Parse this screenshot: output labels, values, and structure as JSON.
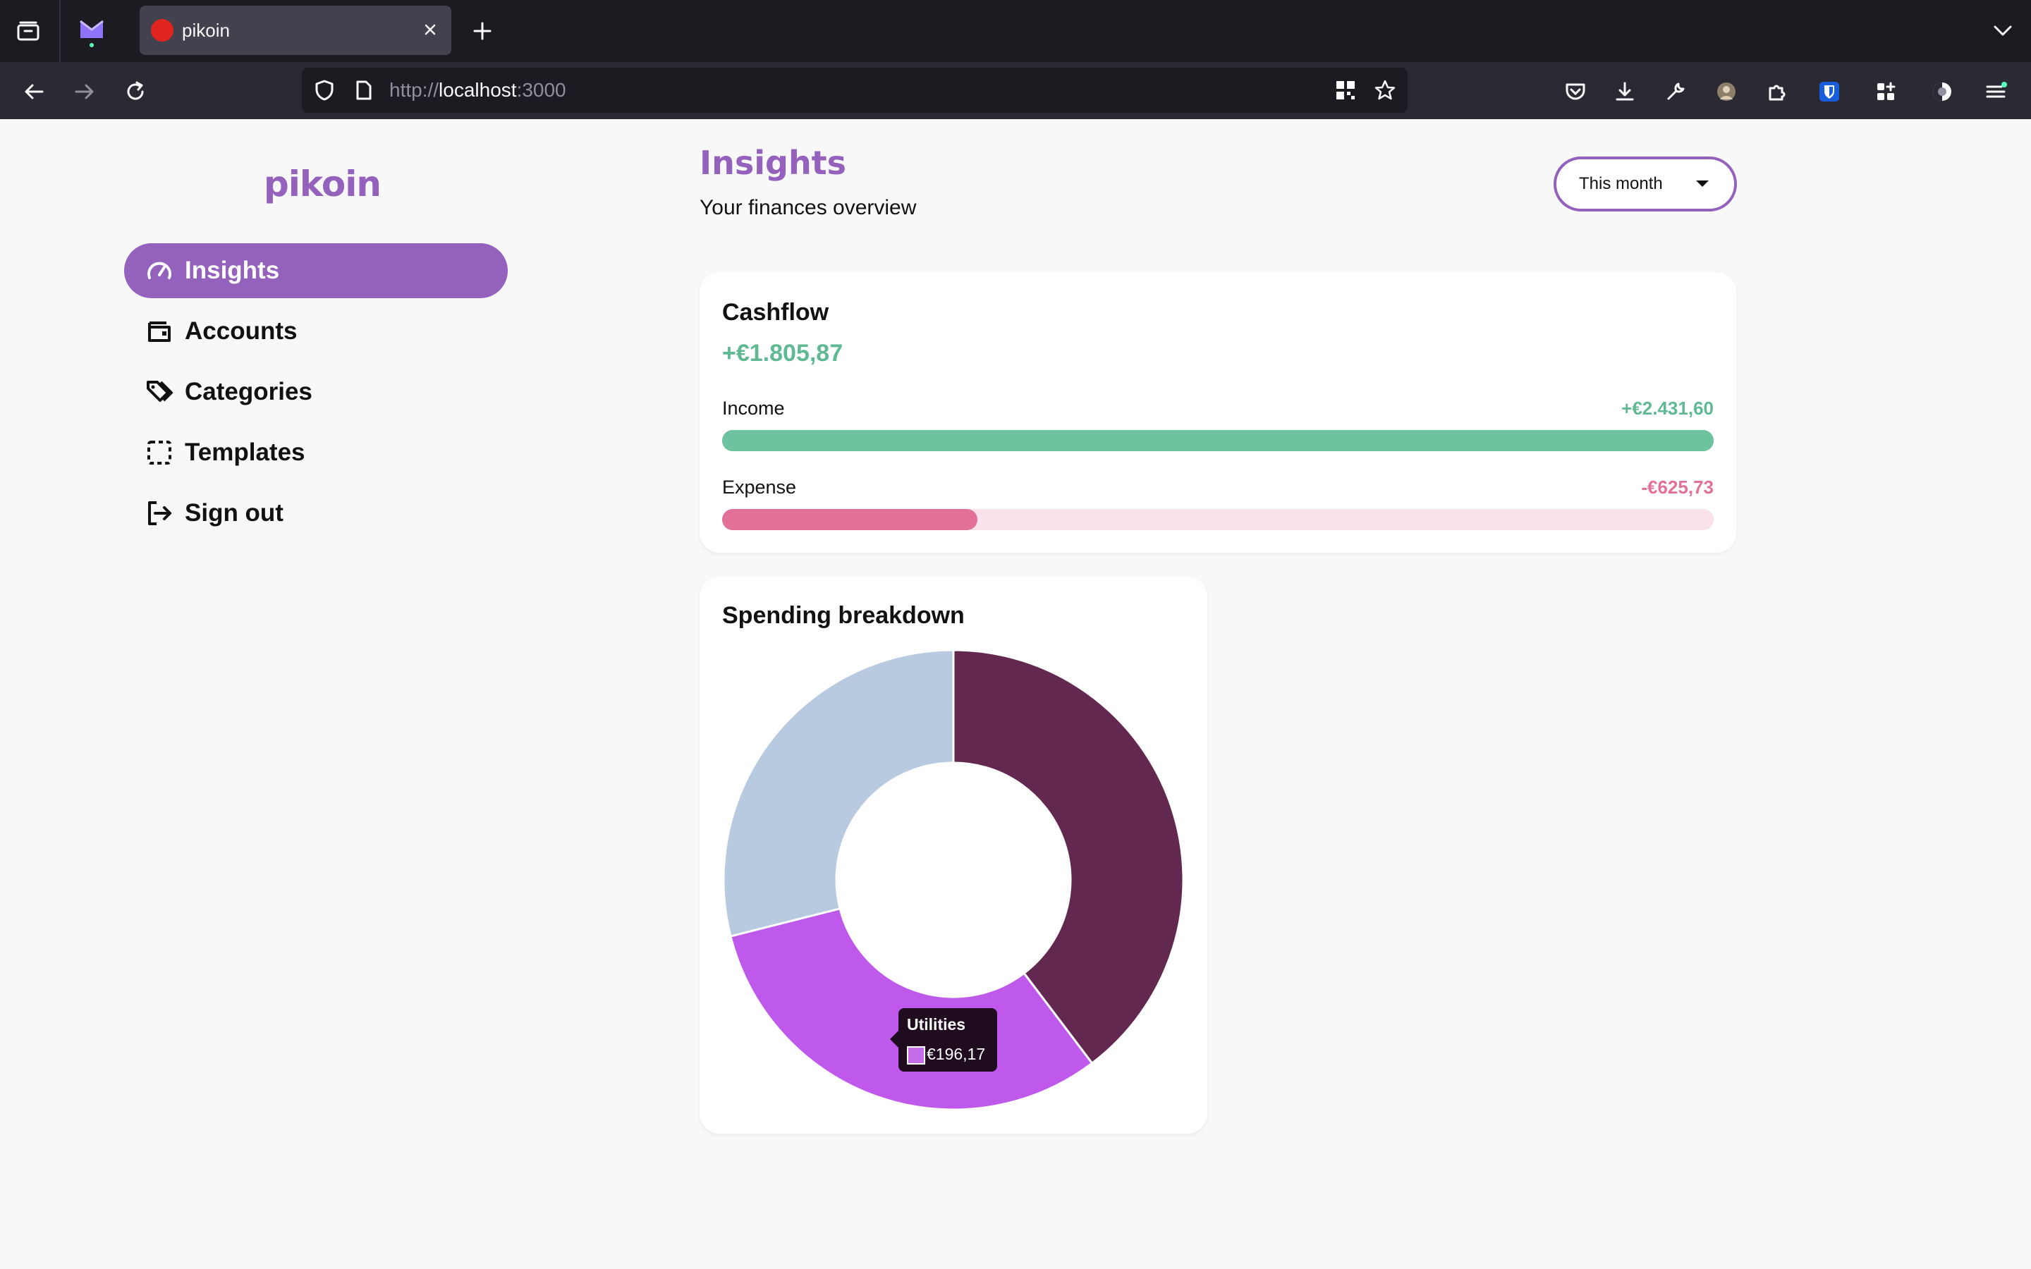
{
  "browser": {
    "tab_title": "pikoin",
    "url_prefix": "http://",
    "url_host": "localhost",
    "url_suffix": ":3000"
  },
  "sidebar": {
    "brand": "pikoin",
    "items": [
      {
        "label": "Insights",
        "icon": "gauge-icon",
        "active": true
      },
      {
        "label": "Accounts",
        "icon": "wallet-icon",
        "active": false
      },
      {
        "label": "Categories",
        "icon": "tags-icon",
        "active": false
      },
      {
        "label": "Templates",
        "icon": "dashed-square-icon",
        "active": false
      },
      {
        "label": "Sign out",
        "icon": "sign-out-icon",
        "active": false
      }
    ]
  },
  "header": {
    "title": "Insights",
    "subtitle": "Your finances overview",
    "period": "This month"
  },
  "cashflow": {
    "title": "Cashflow",
    "total": "+€1.805,87",
    "income_label": "Income",
    "income_value": "+€2.431,60",
    "income_fraction": 1.0,
    "expense_label": "Expense",
    "expense_value": "-€625,73",
    "expense_fraction": 0.2573,
    "colors": {
      "income": "#6dc39d",
      "expense": "#e27099",
      "expense_track": "#f9e2ea",
      "total": "#5fb993"
    }
  },
  "spending": {
    "title": "Spending breakdown",
    "tooltip_label": "Utilities",
    "tooltip_value": "€196,17"
  },
  "chart_data": {
    "type": "pie",
    "variant": "donut",
    "title": "Spending breakdown",
    "series": [
      {
        "name": "",
        "value": 0.397,
        "color": "#62284f"
      },
      {
        "name": "Utilities",
        "value": 0.3135,
        "color": "#bf59ec"
      },
      {
        "name": "",
        "value": 0.2895,
        "color": "#b7cae0"
      }
    ],
    "tooltip": {
      "label": "Utilities",
      "value": "€196,17"
    }
  }
}
